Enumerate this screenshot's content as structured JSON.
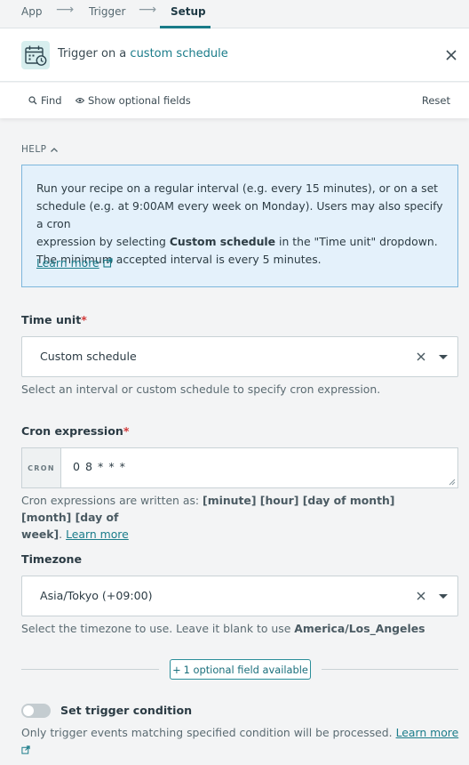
{
  "breadcrumb": {
    "items": [
      "App",
      "Trigger",
      "Setup"
    ],
    "active_index": 2
  },
  "trigger": {
    "prefix": "Trigger",
    "middle": "on a",
    "link": "custom schedule",
    "icon": "calendar-clock-icon"
  },
  "toolbar": {
    "find_label": "Find",
    "optional_label": "Show optional fields",
    "reset_label": "Reset"
  },
  "help": {
    "heading": "HELP",
    "line1": "Run your recipe on a regular interval (e.g. every 15 minutes), or on a set",
    "line2": "schedule (e.g. at 9:00AM every week on Monday). Users may also specify a cron",
    "line3_pre": "expression by selecting",
    "line3_bold": "Custom schedule",
    "line3_post": "in the \"Time unit\" dropdown.",
    "line4": "The minimum accepted interval is every 5 minutes.",
    "learn_more": "Learn more"
  },
  "time_unit": {
    "label": "Time unit",
    "required": "*",
    "value": "Custom schedule",
    "hint": "Select an interval or custom schedule to specify cron expression."
  },
  "cron": {
    "label": "Cron expression",
    "required": "*",
    "tag": "CRON",
    "value": "0 8 * * *",
    "hint_pre": "Cron expressions are written as:",
    "hint_bold1": "[minute] [hour] [day of month] [month] [day of",
    "hint_bold2": "week]",
    "hint_post": ".",
    "learn_more": "Learn more"
  },
  "timezone": {
    "label": "Timezone",
    "value": "Asia/Tokyo (+09:00)",
    "hint_pre": "Select the timezone to use. Leave it blank to use",
    "hint_bold": "America/Los_Angeles"
  },
  "optional_fields": {
    "label": "1 optional field available",
    "prefix": "+"
  },
  "trigger_condition": {
    "label": "Set trigger condition",
    "enabled": false,
    "hint": "Only trigger events matching specified condition will be processed.",
    "learn_more": "Learn more"
  },
  "colors": {
    "accent": "#197b88",
    "link": "#1b7c8a",
    "required": "#d23a3a",
    "help_bg": "#e4f1fb",
    "help_border": "#7cb6dc"
  }
}
